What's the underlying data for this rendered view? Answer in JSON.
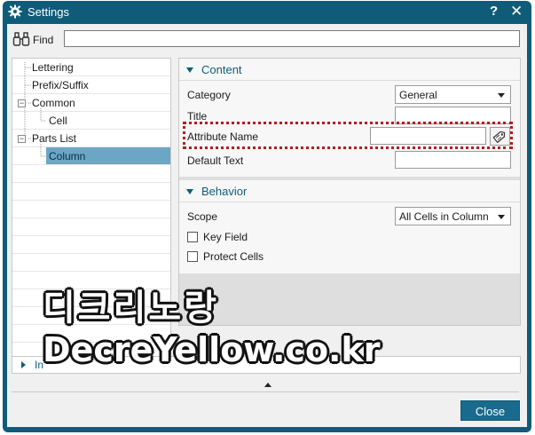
{
  "window": {
    "title": "Settings",
    "help_label": "?",
    "close_label": "✕"
  },
  "find": {
    "label": "Find",
    "value": ""
  },
  "tree": {
    "items": [
      {
        "label": "Lettering"
      },
      {
        "label": "Prefix/Suffix"
      },
      {
        "label": "Common",
        "expander": "⊟"
      },
      {
        "label": "Cell"
      },
      {
        "label": "Parts List",
        "expander": "⊟"
      },
      {
        "label": "Column",
        "selected": true
      }
    ]
  },
  "content": {
    "title": "Content",
    "category": {
      "label": "Category",
      "value": "General"
    },
    "title_field": {
      "label": "Title",
      "value": ""
    },
    "attribute_name": {
      "label": "Attribute Name",
      "value": ""
    },
    "default_text": {
      "label": "Default Text",
      "value": ""
    }
  },
  "behavior": {
    "title": "Behavior",
    "scope": {
      "label": "Scope",
      "value": "All Cells in Column"
    },
    "key_field": {
      "label": "Key Field",
      "checked": false
    },
    "protect_cells": {
      "label": "Protect Cells",
      "checked": false
    }
  },
  "info": {
    "label": "In"
  },
  "footer": {
    "close_label": "Close"
  },
  "watermark": {
    "korean": "디크리노랑",
    "url": "DecreYellow.co.kr"
  },
  "colors": {
    "titlebar": "#0f5c79",
    "accent": "#0f5c79",
    "selection": "#6ba6c5",
    "highlight": "#b61b1b"
  }
}
